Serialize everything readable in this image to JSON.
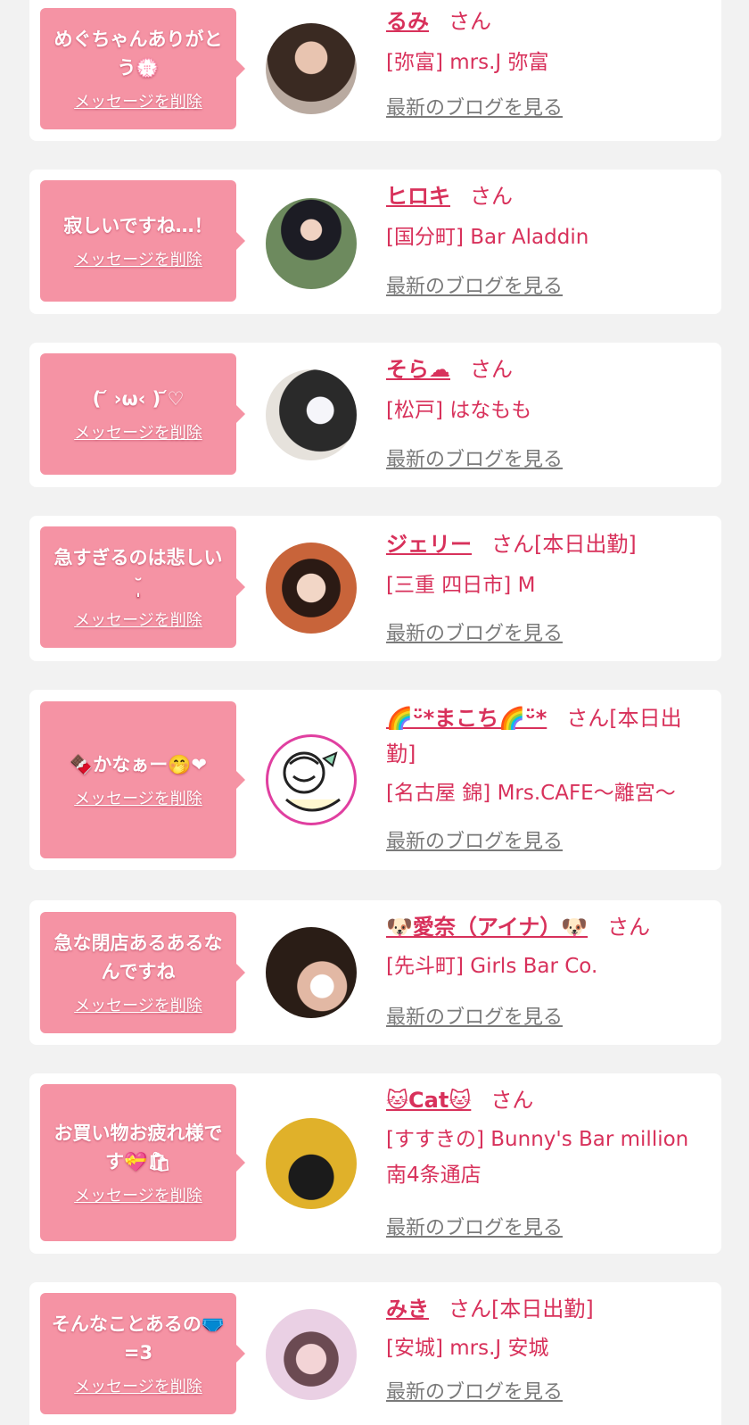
{
  "delete_label": "メッセージを削除",
  "blog_label": "最新のブログを見る",
  "items": [
    {
      "message": "めぐちゃんありがとう💮",
      "name": "るみ",
      "suffix": "さん",
      "shop": "[弥富] mrs.J 弥富"
    },
    {
      "message": "寂しいですね…！",
      "name": "ヒロキ",
      "suffix": "さん",
      "shop": "[国分町] Bar Aladdin"
    },
    {
      "message": "( ᷄ ›ω‹ ) ᷄♡",
      "name": "そら☁",
      "suffix": "さん",
      "shop": "[松戸] はなもも"
    },
    {
      "message": "急すぎるのは悲しい ˘̩̩̩",
      "name": "ジェリー",
      "suffix": "さん[本日出勤]",
      "shop": "[三重 四日市] M"
    },
    {
      "message": "🍫かなぁー🤭❤",
      "name": "🌈ᵕ̈*まこち🌈ᵕ̈*",
      "suffix": "さん[本日出勤]",
      "shop": "[名古屋 錦] Mrs.CAFE〜離宮〜"
    },
    {
      "message": "急な閉店あるあるなんですね",
      "name": "🐶愛奈（アイナ）🐶",
      "suffix": "さん",
      "shop": "[先斗町] Girls Bar Co."
    },
    {
      "message": "お買い物お疲れ様です💝🛍",
      "name": "🐱Cat🐱",
      "suffix": "さん",
      "shop": "[すすきの] Bunny's Bar million 南4条通店"
    },
    {
      "message": "そんなことあるの🩲 =3",
      "name": "みき",
      "suffix": "さん[本日出勤]",
      "shop": "[安城] mrs.J 安城"
    }
  ],
  "colors": {
    "accent": "#d8315b",
    "bubble": "#f593a4",
    "link_gray": "#7a7a7a",
    "background": "#f2f2f2"
  }
}
